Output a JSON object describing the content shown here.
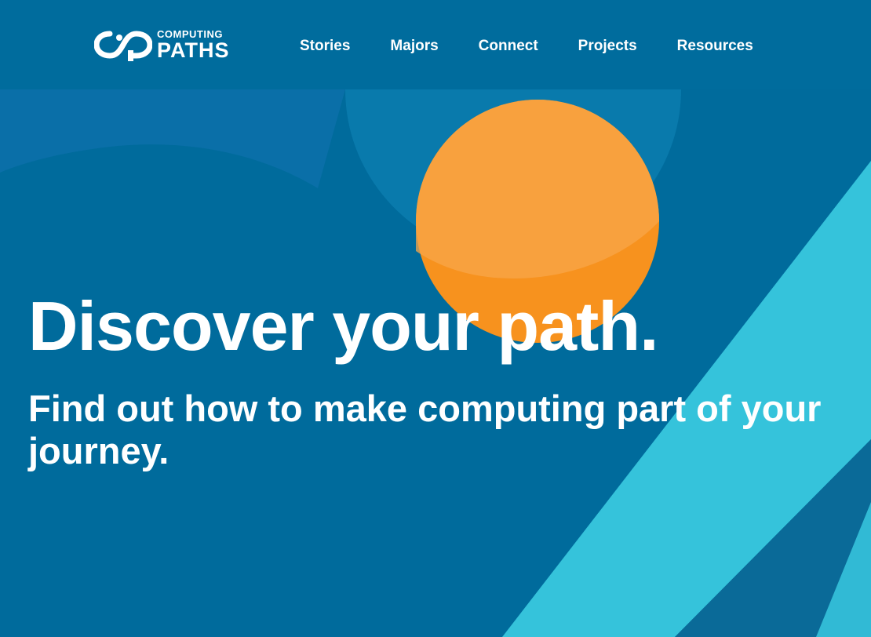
{
  "colors": {
    "background": "#006b9c",
    "header": "#006c9d",
    "accent_orange": "#f7962c",
    "accent_cyan": "#35c3db",
    "text": "#ffffff"
  },
  "logo": {
    "icon": "infinity-path-logo-icon",
    "line1": "COMPUTING",
    "line2": "PATHS"
  },
  "nav": {
    "items": [
      {
        "label": "Stories"
      },
      {
        "label": "Majors"
      },
      {
        "label": "Connect"
      },
      {
        "label": "Projects"
      },
      {
        "label": "Resources"
      }
    ]
  },
  "hero": {
    "title": "Discover your path.",
    "subtitle": "Find out how to make computing part of your journey."
  }
}
